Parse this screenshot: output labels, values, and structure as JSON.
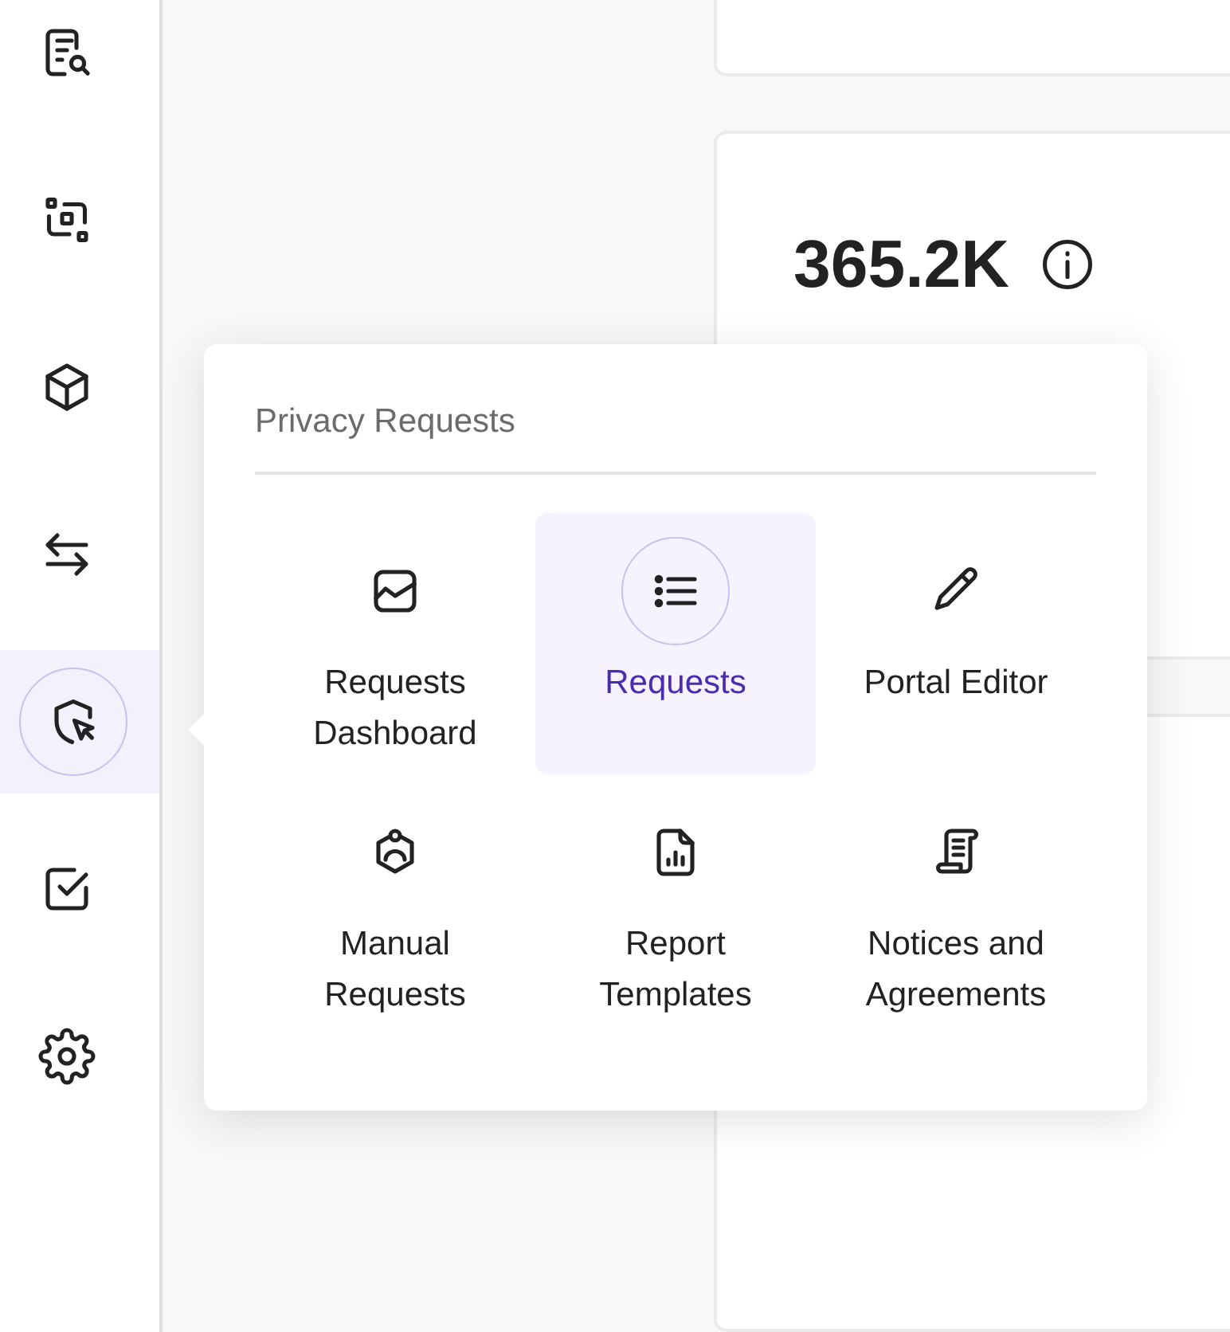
{
  "sidebar": {
    "items": [
      {
        "selected": false
      },
      {
        "selected": false
      },
      {
        "selected": false
      },
      {
        "selected": false
      },
      {
        "selected": true
      },
      {
        "selected": false
      },
      {
        "selected": false
      }
    ]
  },
  "stat_card": {
    "value": "365.2K"
  },
  "popup": {
    "title": "Privacy Requests",
    "items": [
      {
        "label": "Requests Dashboard",
        "selected": false
      },
      {
        "label": "Requests",
        "selected": true
      },
      {
        "label": "Portal Editor",
        "selected": false
      },
      {
        "label": "Manual Requests",
        "selected": false
      },
      {
        "label": "Report Templates",
        "selected": false
      },
      {
        "label": "Notices and Agreements",
        "selected": false
      }
    ]
  }
}
